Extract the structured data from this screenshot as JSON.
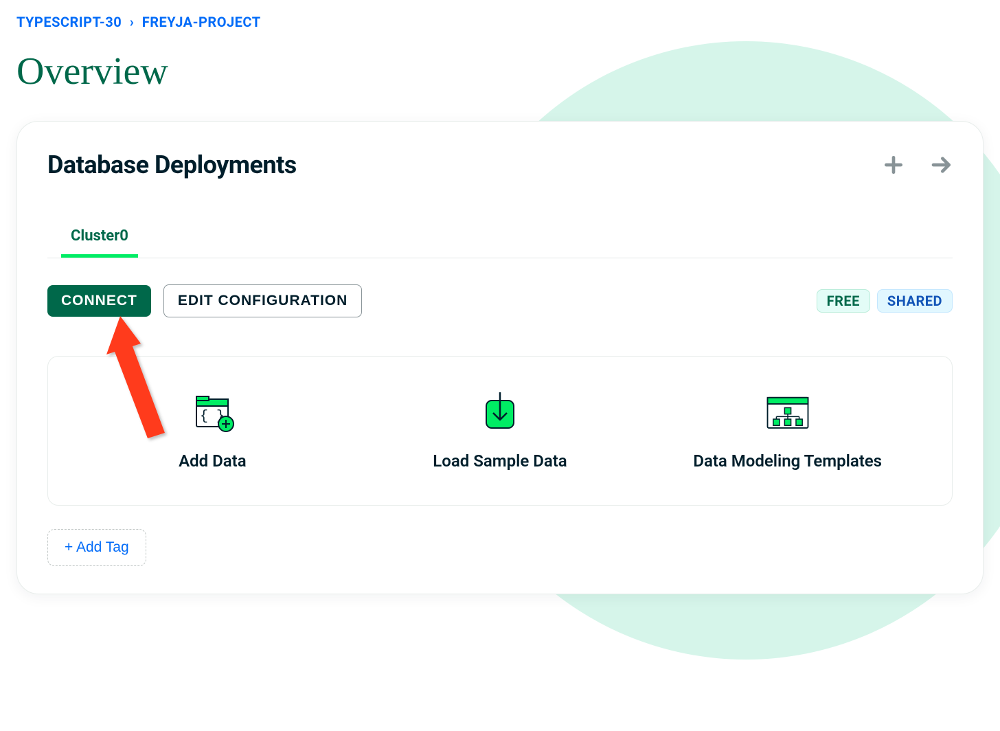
{
  "breadcrumb": {
    "org": "TYPESCRIPT-30",
    "project": "FREYJA-PROJECT"
  },
  "page": {
    "title": "Overview"
  },
  "card": {
    "title": "Database Deployments",
    "cluster_tab": "Cluster0",
    "connect_label": "CONNECT",
    "edit_config_label": "EDIT CONFIGURATION",
    "badge_free": "FREE",
    "badge_shared": "SHARED",
    "options": {
      "add_data": "Add Data",
      "load_sample": "Load Sample Data",
      "data_modeling": "Data Modeling Templates"
    },
    "add_tag_label": "+ Add Tag"
  }
}
